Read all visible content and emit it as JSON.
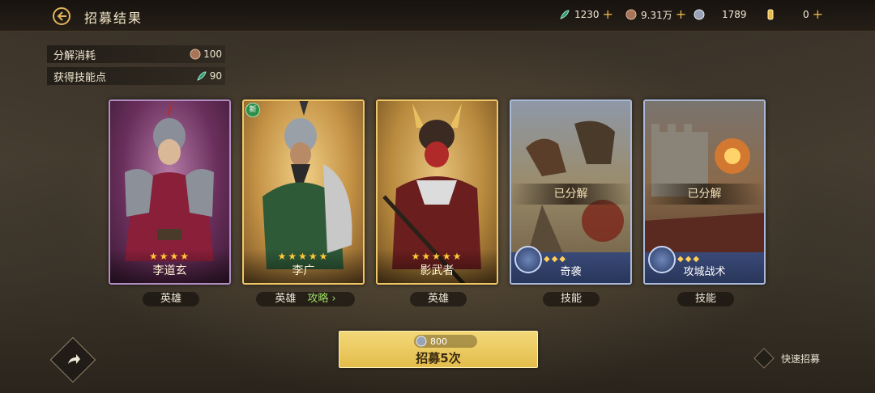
{
  "header": {
    "title": "招募结果",
    "resources": [
      {
        "icon": "jade-feather-icon",
        "value": "1230",
        "color": "#2f9a76"
      },
      {
        "icon": "bronze-coin-icon",
        "value": "9.31万",
        "color": "#a8755a"
      },
      {
        "icon": "silver-coin-icon",
        "value": "1789",
        "color": "#b8c0d0"
      },
      {
        "icon": "gold-bar-icon",
        "value": "0",
        "color": "#e8b84a"
      }
    ]
  },
  "costs": [
    {
      "label": "分解消耗",
      "value": "100",
      "icon": "bronze-coin-icon"
    },
    {
      "label": "获得技能点",
      "value": "90",
      "icon": "jade-feather-icon"
    }
  ],
  "cards": [
    {
      "kind": "hero",
      "name": "李道玄",
      "stars": "★★★★",
      "type": "英雄",
      "theme": "#7a3a6a",
      "frame": "#b08cc0"
    },
    {
      "kind": "hero",
      "name": "李广",
      "stars": "★★★★★",
      "type": "英雄",
      "guide": "攻略 ›",
      "new": "新",
      "theme": "#b98a3a",
      "frame": "#f0c766"
    },
    {
      "kind": "hero",
      "name": "影武者",
      "stars": "★★★★★",
      "type": "英雄",
      "theme": "#a7772e",
      "frame": "#f0c766"
    },
    {
      "kind": "skill",
      "name": "奇袭",
      "status": "已分解",
      "diamonds": "◆◆◆",
      "type": "技能",
      "theme": "#6a6a70",
      "frame": "#aab8d8"
    },
    {
      "kind": "skill",
      "name": "攻城战术",
      "status": "已分解",
      "diamonds": "◆◆◆",
      "type": "技能",
      "theme": "#6a5a50",
      "frame": "#aab8d8"
    }
  ],
  "recruit": {
    "cost": "800",
    "label": "招募5次"
  },
  "quick_recruit": "快速招募"
}
